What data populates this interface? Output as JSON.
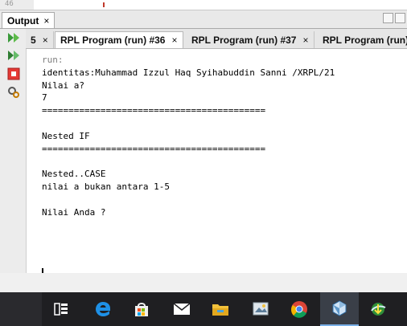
{
  "editor": {
    "line_number": "46"
  },
  "output_window": {
    "tab_label": "Output",
    "close_glyph": "×"
  },
  "run_tabs": [
    {
      "label": "5",
      "close": "×"
    },
    {
      "label": "RPL Program (run) #36",
      "close": "×"
    },
    {
      "label": "RPL Program (run) #37",
      "close": "×"
    },
    {
      "label": "RPL Program (run)",
      "close": ""
    }
  ],
  "toolbar_icons": [
    "rerun-icon",
    "rerun-with-options-icon",
    "stop-icon",
    "settings-icon"
  ],
  "console": {
    "lines": [
      "run:",
      "identitas:Muhammad Izzul Haq Syihabuddin Sanni /XRPL/21",
      "Nilai a?",
      "7",
      "==========================================",
      "",
      "Nested IF",
      "==========================================",
      "",
      "Nested..CASE",
      "nilai a bukan antara 1-5",
      "",
      "Nilai Anda ?"
    ]
  },
  "taskbar": {
    "icons": [
      "task-view-icon",
      "edge-icon",
      "store-icon",
      "mail-icon",
      "file-explorer-icon",
      "photos-icon",
      "chrome-icon",
      "netbeans-icon",
      "download-manager-icon"
    ]
  },
  "colors": {
    "accent": "#3c8ee8",
    "taskbar": "#1f1f22"
  }
}
